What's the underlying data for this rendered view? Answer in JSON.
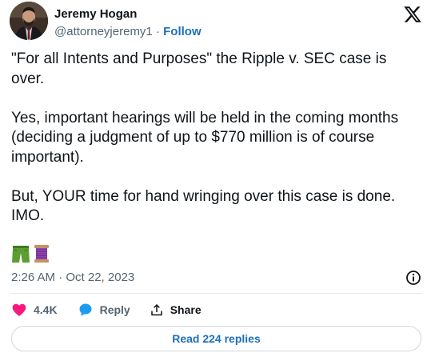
{
  "author": {
    "name": "Jeremy Hogan",
    "handle": "@attorneyjeremy1",
    "separator": "·",
    "follow_label": "Follow"
  },
  "tweet": {
    "paragraphs": [
      "\"For all Intents and Purposes\" the Ripple v. SEC case is over.",
      "Yes, important hearings will be held in the coming months (deciding a judgment of up to $770 million is of course important).",
      "But, YOUR time for hand wringing over this case is done. IMO."
    ],
    "emojis": [
      "shorts-emoji",
      "spool-of-thread-emoji"
    ],
    "timestamp": "2:26 AM · Oct 22, 2023"
  },
  "actions": {
    "like_count": "4.4K",
    "reply_label": "Reply",
    "share_label": "Share"
  },
  "read_replies_label": "Read 224 replies",
  "colors": {
    "like": "#f91880",
    "reply": "#1d9bf0",
    "link": "#1d6fb8",
    "secondary_text": "#536471",
    "border": "#cfd9de"
  }
}
